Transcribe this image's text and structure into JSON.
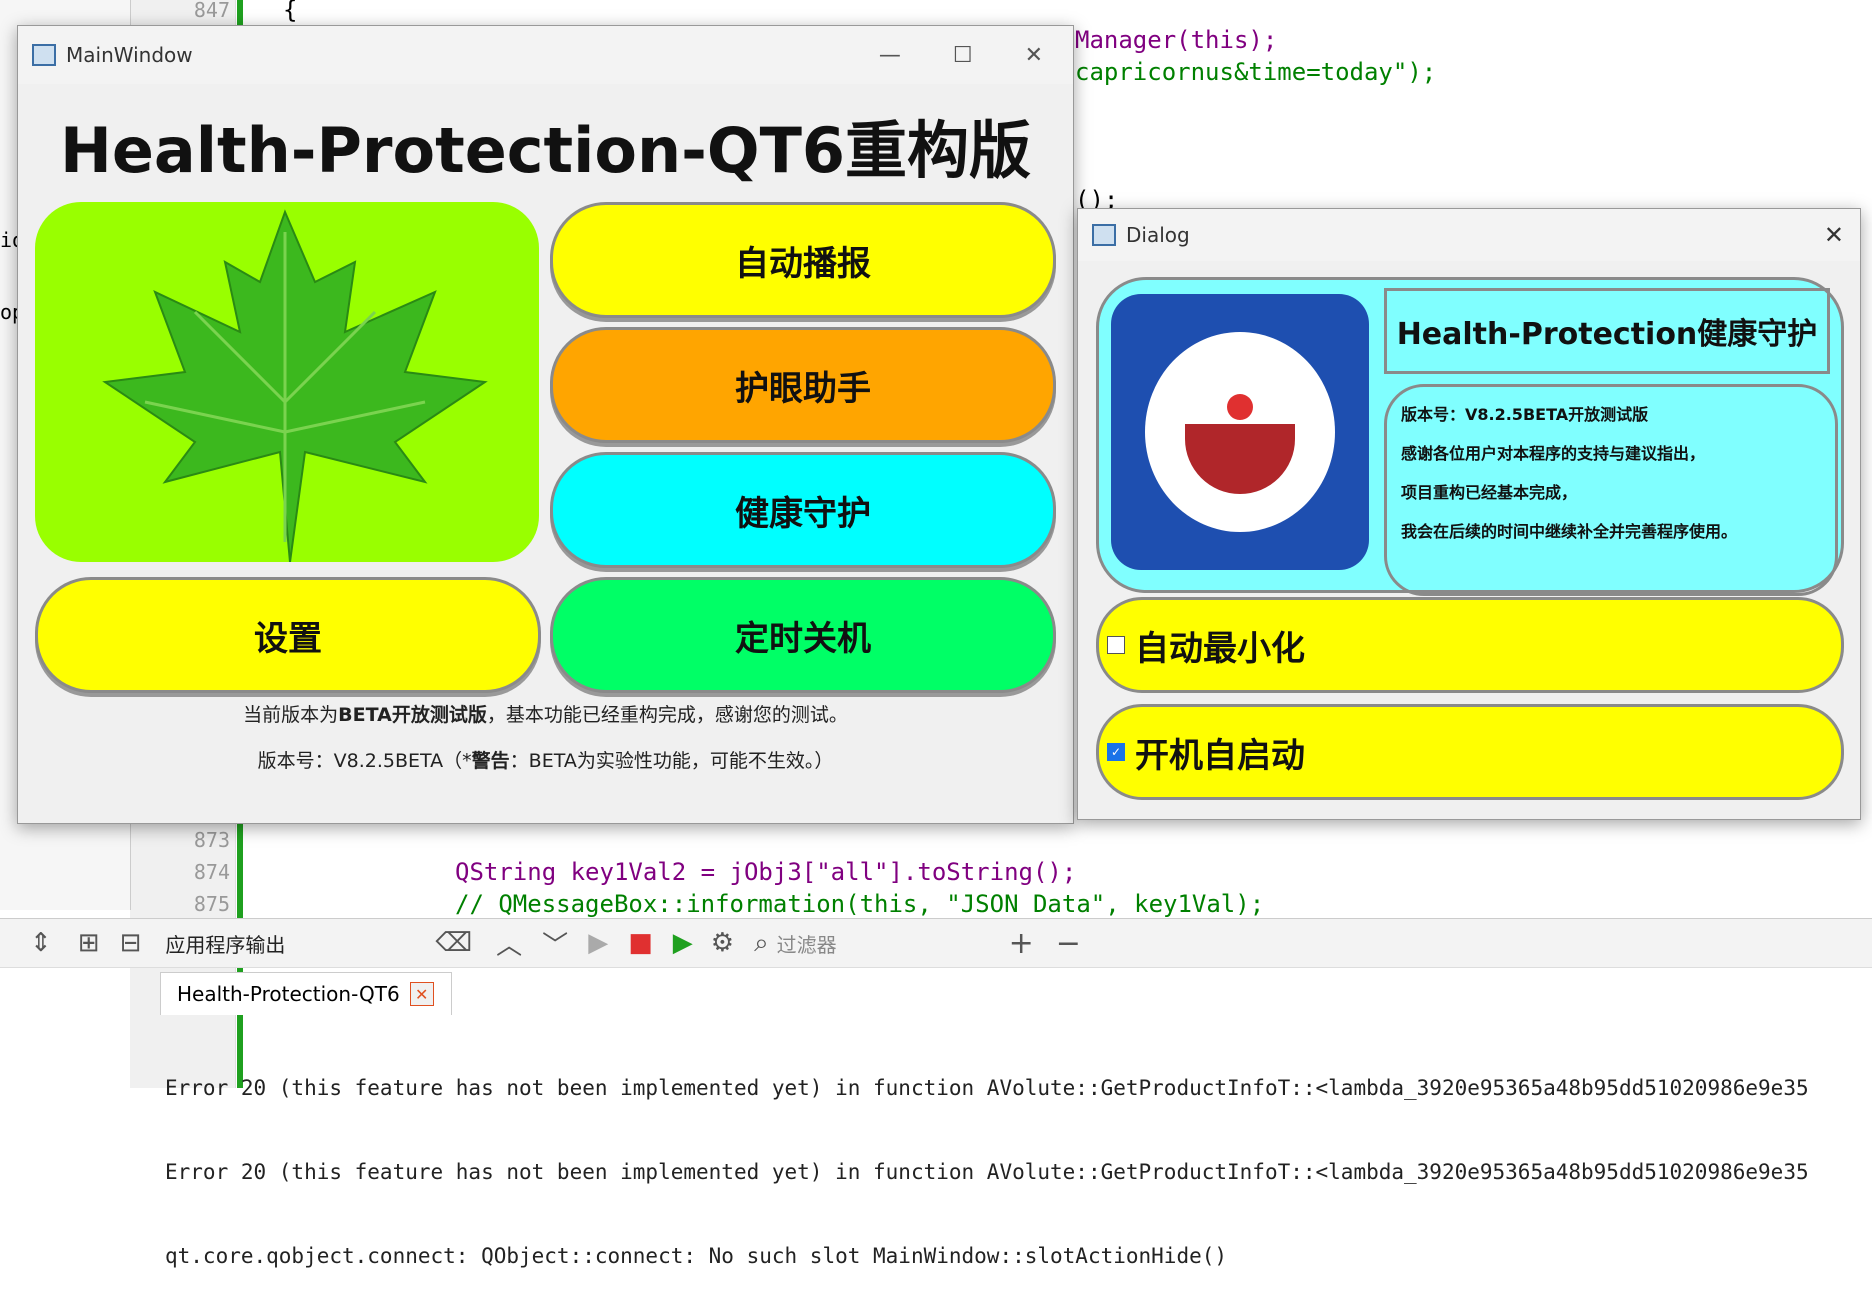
{
  "editor": {
    "ln_top": "847",
    "ln1": "873",
    "ln2": "874",
    "ln3": "875",
    "code_r1": "Manager(this);",
    "code_r2": "capricornus&time=today\");",
    "code_r3": "();",
    "code_b1": "QString key1Val2 = jObj3[\"all\"].toString();",
    "code_b2": "// QMessageBox::information(this, \"JSON Data\", key1Val);",
    "brace": "{",
    "side1": "io",
    "side2": "op"
  },
  "main": {
    "title": "MainWindow",
    "heading": "Health-Protection-QT6重构版",
    "buttons": {
      "auto": "自动播报",
      "eye": "护眼助手",
      "health": "健康守护",
      "settings": "设置",
      "shutdown": "定时关机"
    },
    "colors": {
      "leaf_bg": "#99ff00",
      "yellow": "#ffff00",
      "orange": "#ffa500",
      "cyan": "#00ffff",
      "green": "#00ff66"
    },
    "note_pre": "当前版本为",
    "note_bold": "BETA开放测试版",
    "note_post": "，基本功能已经重构完成，感谢您的测试。",
    "ver_pre": "版本号：V8.2.5BETA（*",
    "ver_bold": "警告",
    "ver_post": "：BETA为实验性功能，可能不生效。）"
  },
  "dialog": {
    "title": "Dialog",
    "heading": "Health-Protection健康守护",
    "lines": [
      "版本号：V8.2.5BETA开放测试版",
      "感谢各位用户对本程序的支持与建议指出，",
      "项目重构已经基本完成，",
      "我会在后续的时间中继续补全并完善程序使用。"
    ],
    "auto_min": "自动最小化",
    "auto_start": "开机自启动",
    "auto_min_checked": false,
    "auto_start_checked": true
  },
  "output": {
    "pane_title": "应用程序输出",
    "filter_placeholder": "过滤器",
    "tab": "Health-Protection-QT6",
    "lines": [
      "Error 20 (this feature has not been implemented yet) in function AVolute::GetProductInfoT::<lambda_3920e95365a48b95dd51020986e9e35",
      "Error 20 (this feature has not been implemented yet) in function AVolute::GetProductInfoT::<lambda_3920e95365a48b95dd51020986e9e35",
      "qt.core.qobject.connect: QObject::connect: No such slot MainWindow::slotActionHide()"
    ]
  }
}
